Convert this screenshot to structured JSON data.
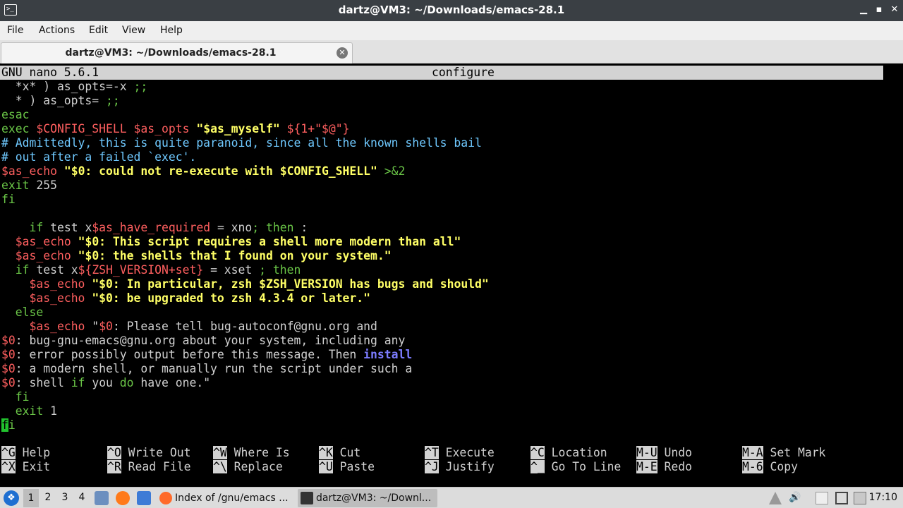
{
  "window": {
    "title": "dartz@VM3: ~/Downloads/emacs-28.1",
    "minimize": "▁",
    "maximize": "▪",
    "close": "✕"
  },
  "menubar": [
    "File",
    "Actions",
    "Edit",
    "View",
    "Help"
  ],
  "tab": {
    "label": "dartz@VM3: ~/Downloads/emacs-28.1",
    "close": "✕"
  },
  "nano": {
    "version": "GNU nano 5.6.1",
    "filename": "configure"
  },
  "code_lines": [
    [
      [
        "w",
        "  *x* ) as_opts=-x "
      ],
      [
        "g",
        ";;"
      ]
    ],
    [
      [
        "w",
        "  * ) as_opts= "
      ],
      [
        "g",
        ";;"
      ]
    ],
    [
      [
        "g",
        "esac"
      ]
    ],
    [
      [
        "g",
        "exec "
      ],
      [
        "r",
        "$CONFIG_SHELL"
      ],
      [
        "w",
        " "
      ],
      [
        "r",
        "$as_opts"
      ],
      [
        "w",
        " "
      ],
      [
        "y",
        "\"$as_myself\""
      ],
      [
        "w",
        " "
      ],
      [
        "r",
        "${1+\"$@\"}"
      ]
    ],
    [
      [
        "c",
        "# Admittedly, this is quite paranoid, since all the known shells bail"
      ]
    ],
    [
      [
        "c",
        "# out after a failed `exec'."
      ]
    ],
    [
      [
        "r",
        "$as_echo"
      ],
      [
        "w",
        " "
      ],
      [
        "y",
        "\"$0: could not re-execute with $CONFIG_SHELL\""
      ],
      [
        "w",
        " "
      ],
      [
        "g",
        ">&2"
      ]
    ],
    [
      [
        "g",
        "exit"
      ],
      [
        "w",
        " 255"
      ]
    ],
    [
      [
        "g",
        "fi"
      ]
    ],
    [
      [
        "w",
        ""
      ]
    ],
    [
      [
        "w",
        "    "
      ],
      [
        "g",
        "if"
      ],
      [
        "w",
        " test x"
      ],
      [
        "r",
        "$as_have_required"
      ],
      [
        "w",
        " = xno"
      ],
      [
        "g",
        "; then"
      ],
      [
        "w",
        " :"
      ]
    ],
    [
      [
        "w",
        "  "
      ],
      [
        "r",
        "$as_echo"
      ],
      [
        "w",
        " "
      ],
      [
        "y",
        "\"$0: This script requires a shell more modern than all\""
      ]
    ],
    [
      [
        "w",
        "  "
      ],
      [
        "r",
        "$as_echo"
      ],
      [
        "w",
        " "
      ],
      [
        "y",
        "\"$0: the shells that I found on your system.\""
      ]
    ],
    [
      [
        "w",
        "  "
      ],
      [
        "g",
        "if"
      ],
      [
        "w",
        " test x"
      ],
      [
        "r",
        "${ZSH_VERSION+set}"
      ],
      [
        "w",
        " = xset "
      ],
      [
        "g",
        "; then"
      ]
    ],
    [
      [
        "w",
        "    "
      ],
      [
        "r",
        "$as_echo"
      ],
      [
        "w",
        " "
      ],
      [
        "y",
        "\"$0: In particular, zsh $ZSH_VERSION has bugs and should\""
      ]
    ],
    [
      [
        "w",
        "    "
      ],
      [
        "r",
        "$as_echo"
      ],
      [
        "w",
        " "
      ],
      [
        "y",
        "\"$0: be upgraded to zsh 4.3.4 or later.\""
      ]
    ],
    [
      [
        "w",
        "  "
      ],
      [
        "g",
        "else"
      ]
    ],
    [
      [
        "w",
        "    "
      ],
      [
        "r",
        "$as_echo"
      ],
      [
        "w",
        " \""
      ],
      [
        "r",
        "$0"
      ],
      [
        "w",
        ": Please tell bug-autoconf@gnu.org and"
      ]
    ],
    [
      [
        "r",
        "$0"
      ],
      [
        "w",
        ": bug-gnu-emacs@gnu.org about your system, including any"
      ]
    ],
    [
      [
        "r",
        "$0"
      ],
      [
        "w",
        ": error possibly output before this message. Then "
      ],
      [
        "b",
        "install"
      ]
    ],
    [
      [
        "r",
        "$0"
      ],
      [
        "w",
        ": a modern shell, or manually run the script under such a"
      ]
    ],
    [
      [
        "r",
        "$0"
      ],
      [
        "w",
        ": shell "
      ],
      [
        "g",
        "if"
      ],
      [
        "w",
        " you "
      ],
      [
        "g",
        "do"
      ],
      [
        "w",
        " have one.\""
      ]
    ],
    [
      [
        "w",
        "  "
      ],
      [
        "g",
        "fi"
      ]
    ],
    [
      [
        "w",
        "  "
      ],
      [
        "g",
        "exit"
      ],
      [
        "w",
        " 1"
      ]
    ],
    [
      [
        "cur",
        "f"
      ],
      [
        "g",
        "i"
      ]
    ]
  ],
  "shortcuts": [
    {
      "key": "^G",
      "label": "Help"
    },
    {
      "key": "^X",
      "label": "Exit"
    },
    {
      "key": "^O",
      "label": "Write Out"
    },
    {
      "key": "^R",
      "label": "Read File"
    },
    {
      "key": "^W",
      "label": "Where Is"
    },
    {
      "key": "^\\",
      "label": "Replace"
    },
    {
      "key": "^K",
      "label": "Cut"
    },
    {
      "key": "^U",
      "label": "Paste"
    },
    {
      "key": "^T",
      "label": "Execute"
    },
    {
      "key": "^J",
      "label": "Justify"
    },
    {
      "key": "^C",
      "label": "Location"
    },
    {
      "key": "^_",
      "label": "Go To Line"
    },
    {
      "key": "M-U",
      "label": "Undo"
    },
    {
      "key": "M-E",
      "label": "Redo"
    },
    {
      "key": "M-A",
      "label": "Set Mark"
    },
    {
      "key": "M-6",
      "label": "Copy"
    }
  ],
  "taskbar": {
    "workspaces": [
      "1",
      "2",
      "3",
      "4"
    ],
    "tasks": [
      {
        "label": "Index of /gnu/emacs ...",
        "icon": "firefox-icon"
      },
      {
        "label": "dartz@VM3: ~/Downl...",
        "icon": "terminal-icon"
      }
    ],
    "clock": "17:10"
  },
  "colors": {
    "keyword": "#6ac547",
    "variable": "#ff5f5f",
    "string": "#ffff66",
    "comment": "#6fc9ff",
    "builtin": "#7c7cff",
    "cursor": "#22c32e"
  }
}
